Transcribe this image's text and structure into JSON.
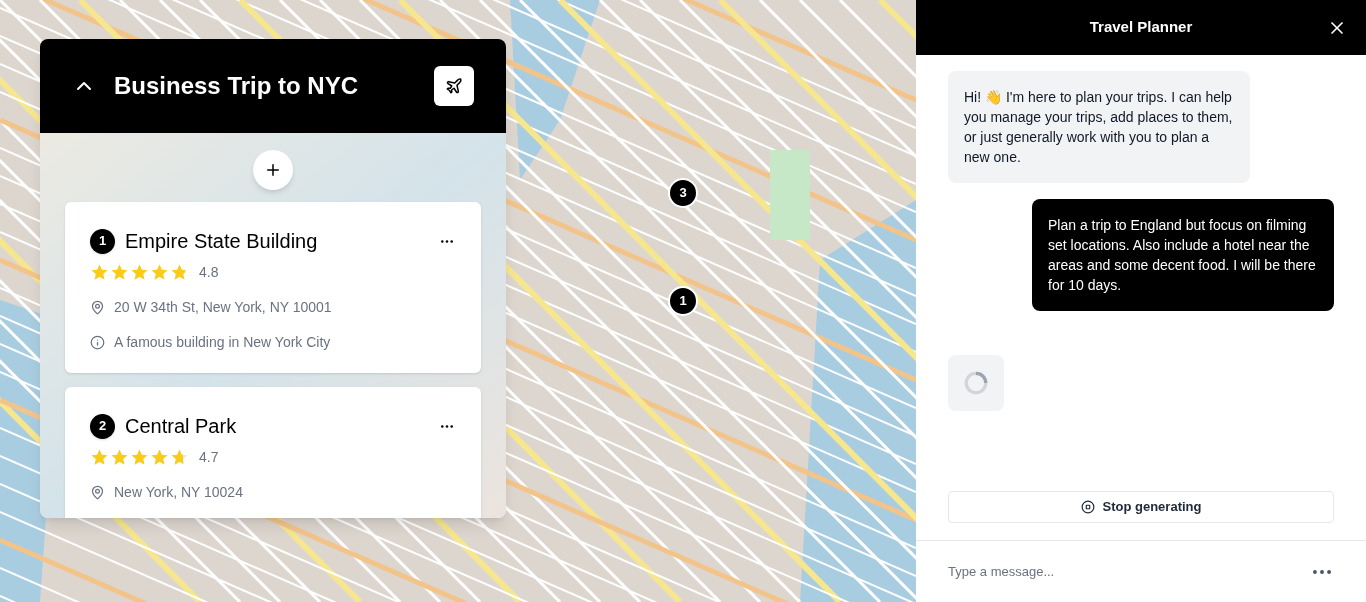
{
  "trip_panel": {
    "title": "Business Trip to NYC",
    "expanded": true,
    "places": [
      {
        "number": "1",
        "name": "Empire State Building",
        "stars": 4.8,
        "rating": "4.8",
        "address": "20 W 34th St, New York, NY 10001",
        "description": "A famous building in New York City"
      },
      {
        "number": "2",
        "name": "Central Park",
        "stars": 4.7,
        "rating": "4.7",
        "address": "New York, NY 10024"
      }
    ]
  },
  "map_pins": [
    {
      "label": "3"
    },
    {
      "label": "1"
    }
  ],
  "chat": {
    "title": "Travel Planner",
    "messages": [
      {
        "kind": "bot",
        "text": "Hi! 👋 I'm here to plan your trips. I can help you manage your trips, add places to them, or just generally work with you to plan a new one."
      },
      {
        "kind": "user",
        "text": "Plan a trip to England but focus on filming set locations. Also include a hotel near the areas and some decent food. I will be there for 10 days."
      },
      {
        "kind": "loading"
      }
    ],
    "stop_button": "Stop generating",
    "input": {
      "placeholder": "Type a message..."
    }
  }
}
